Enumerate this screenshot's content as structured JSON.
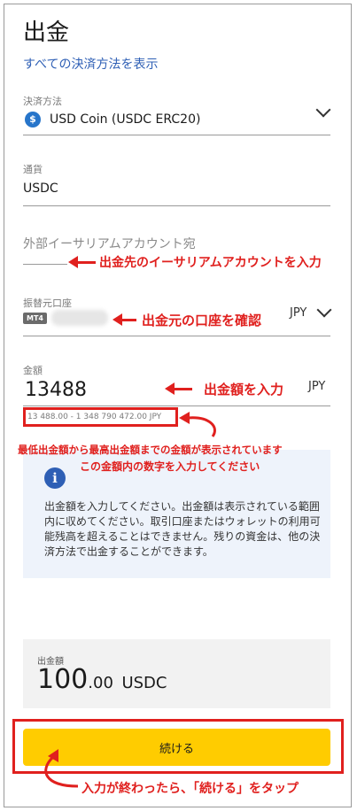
{
  "header": {
    "title": "出金",
    "show_all_methods_link": "すべての決済方法を表示"
  },
  "payment_method": {
    "label": "決済方法",
    "value": "USD Coin (USDC ERC20)",
    "icon": "usdc-icon"
  },
  "currency": {
    "label": "通貨",
    "value": "USDC"
  },
  "external_account": {
    "placeholder": "外部イーサリアムアカウント宛",
    "value": ""
  },
  "source_account": {
    "label": "振替元口座",
    "badge": "MT4",
    "currency": "JPY"
  },
  "amount": {
    "label": "金額",
    "value": "13488",
    "currency": "JPY",
    "range": "13 488.00 - 1 348 790 472.00 JPY"
  },
  "info": {
    "text": "出金額を入力してください。出金額は表示されている範囲内に収めてください。取引口座またはウォレットの利用可能残高を超えることはできません。残りの資金は、他の決済方法で出金することができます。"
  },
  "summary": {
    "label": "出金額",
    "amount_int": "100",
    "amount_dec": ".00",
    "currency": "USDC"
  },
  "cta": {
    "label": "続ける"
  },
  "annotations": {
    "external_account": "出金先のイーサリアムアカウントを入力",
    "source_account": "出金元の口座を確認",
    "amount": "出金額を入力",
    "range_line1": "最低出金額から最高出金額までの金額が表示されています",
    "range_line2": "この金額内の数字を入力してください",
    "cta": "入力が終わったら、「続ける」をタップ"
  },
  "colors": {
    "accent": "#2e5fb5",
    "cta": "#ffcc00",
    "annotation": "#e0201e",
    "usdc": "#2775ca"
  }
}
